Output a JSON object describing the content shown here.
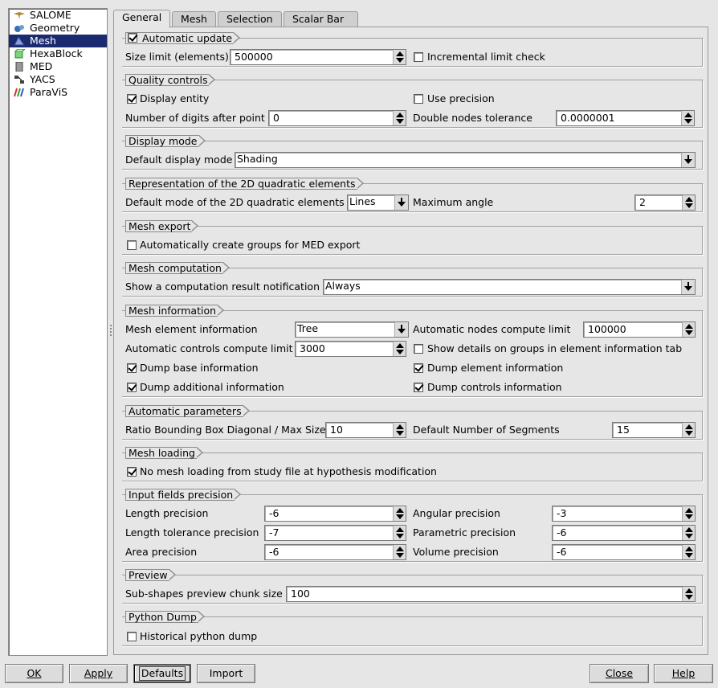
{
  "modules": [
    {
      "label": "SALOME",
      "icon": "salome-icon"
    },
    {
      "label": "Geometry",
      "icon": "geometry-icon"
    },
    {
      "label": "Mesh",
      "icon": "mesh-icon",
      "selected": true
    },
    {
      "label": "HexaBlock",
      "icon": "hexablock-icon"
    },
    {
      "label": "MED",
      "icon": "med-icon"
    },
    {
      "label": "YACS",
      "icon": "yacs-icon"
    },
    {
      "label": "ParaViS",
      "icon": "paravis-icon"
    }
  ],
  "tabs": [
    "General",
    "Mesh",
    "Selection",
    "Scalar Bar"
  ],
  "general": {
    "auto_update": {
      "title": "Automatic update",
      "checked": true,
      "size_limit_label": "Size limit (elements)",
      "size_limit": "500000",
      "incremental_label": "Incremental limit check",
      "incremental": false
    },
    "quality": {
      "title": "Quality controls",
      "display_entity": "Display entity",
      "use_precision": "Use precision",
      "digits_label": "Number of digits after point",
      "digits": "0",
      "double_nodes_label": "Double nodes tolerance",
      "double_nodes": "0.0000001"
    },
    "display_mode": {
      "title": "Display mode",
      "label": "Default display mode",
      "value": "Shading"
    },
    "quadratic": {
      "title": "Representation of the 2D quadratic elements",
      "label": "Default mode of the 2D quadratic elements",
      "value": "Lines",
      "max_angle_label": "Maximum angle",
      "max_angle": "2"
    },
    "export": {
      "title": "Mesh export",
      "label": "Automatically create groups for MED export"
    },
    "computation": {
      "title": "Mesh computation",
      "label": "Show a computation result notification",
      "value": "Always"
    },
    "info": {
      "title": "Mesh information",
      "elem_info_label": "Mesh element information",
      "elem_info": "Tree",
      "auto_nodes_label": "Automatic nodes compute limit",
      "auto_nodes": "100000",
      "auto_controls_label": "Automatic controls compute limit",
      "auto_controls": "3000",
      "show_details": "Show details on groups in element information tab",
      "dump_base": "Dump base information",
      "dump_element": "Dump element information",
      "dump_additional": "Dump additional information",
      "dump_controls": "Dump controls information"
    },
    "auto_params": {
      "title": "Automatic parameters",
      "ratio_label": "Ratio Bounding Box Diagonal / Max Size",
      "ratio": "10",
      "segments_label": "Default Number of Segments",
      "segments": "15"
    },
    "loading": {
      "title": "Mesh loading",
      "label": "No mesh loading from study file at hypothesis modification"
    },
    "precision": {
      "title": "Input fields precision",
      "length_label": "Length precision",
      "length": "-6",
      "angular_label": "Angular precision",
      "angular": "-3",
      "length_tol_label": "Length tolerance precision",
      "length_tol": "-7",
      "parametric_label": "Parametric precision",
      "parametric": "-6",
      "area_label": "Area precision",
      "area": "-6",
      "volume_label": "Volume precision",
      "volume": "-6"
    },
    "preview": {
      "title": "Preview",
      "label": "Sub-shapes preview chunk size",
      "value": "100"
    },
    "python": {
      "title": "Python Dump",
      "label": "Historical python dump"
    }
  },
  "buttons": {
    "ok": "OK",
    "apply": "Apply",
    "defaults": "Defaults",
    "import": "Import",
    "close": "Close",
    "help": "Help"
  }
}
